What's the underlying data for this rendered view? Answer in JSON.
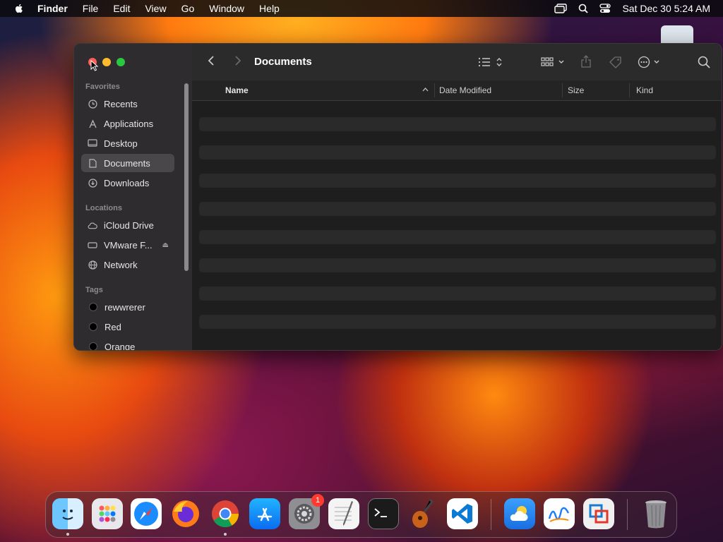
{
  "menubar": {
    "app": "Finder",
    "items": [
      "File",
      "Edit",
      "View",
      "Go",
      "Window",
      "Help"
    ],
    "clock": "Sat Dec 30  5:24 AM"
  },
  "window": {
    "title": "Documents",
    "columns": {
      "name": "Name",
      "date": "Date Modified",
      "size": "Size",
      "kind": "Kind"
    }
  },
  "sidebar": {
    "favorites_header": "Favorites",
    "favorites": [
      "Recents",
      "Applications",
      "Desktop",
      "Documents",
      "Downloads"
    ],
    "selected": "Documents",
    "locations_header": "Locations",
    "locations": [
      "iCloud Drive",
      "VMware F...",
      "Network"
    ],
    "tags_header": "Tags",
    "tags": [
      "rewwrerer",
      "Red",
      "Orange"
    ]
  },
  "dock": {
    "settings_badge": "1",
    "apps": [
      "finder",
      "launchpad",
      "safari",
      "firefox",
      "chrome",
      "app-store",
      "system-settings",
      "textedit",
      "terminal",
      "garageband",
      "vscode",
      "weather",
      "freeform",
      "vmware"
    ]
  },
  "colors": {
    "close": "#ff5f57",
    "minimize": "#febc2e",
    "zoom": "#28c840",
    "sidebar_bg": "#2f2c2f",
    "window_bg": "#1e1e1e"
  }
}
